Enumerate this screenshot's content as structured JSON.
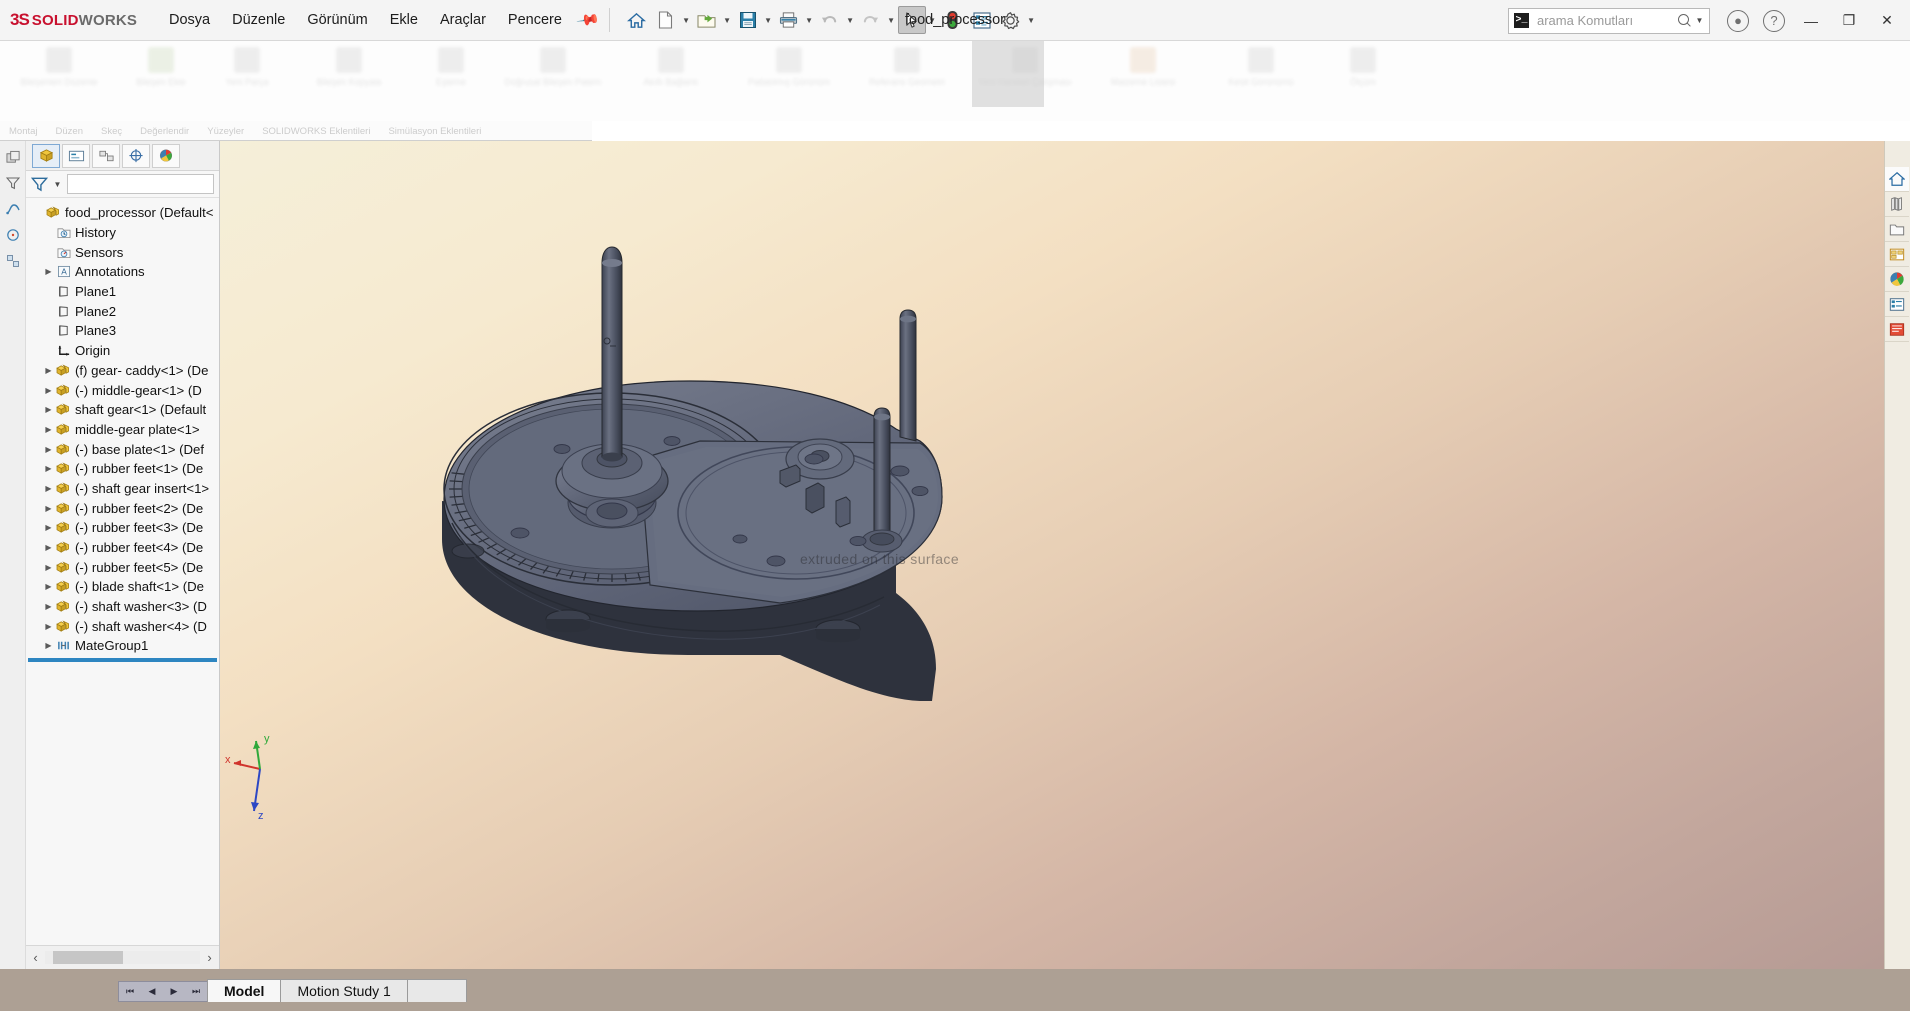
{
  "app": {
    "brand_ds": "3S",
    "brand_solid": "SOLID",
    "brand_works": "WORKS",
    "document_title": "food_processor",
    "accent_color": "#c8102e",
    "selection_color": "#2e86c1"
  },
  "menubar": {
    "items": [
      {
        "label": "Dosya",
        "name": "menu-file"
      },
      {
        "label": "Düzenle",
        "name": "menu-edit"
      },
      {
        "label": "Görünüm",
        "name": "menu-view"
      },
      {
        "label": "Ekle",
        "name": "menu-insert"
      },
      {
        "label": "Araçlar",
        "name": "menu-tools"
      },
      {
        "label": "Pencere",
        "name": "menu-window"
      }
    ],
    "pin_icon": "pushpin-icon"
  },
  "quick_access": {
    "buttons": [
      {
        "name": "home-button",
        "icon": "home-icon",
        "has_caret": false,
        "active": false
      },
      {
        "name": "new-document-button",
        "icon": "new-file-icon",
        "has_caret": true,
        "active": false
      },
      {
        "name": "open-document-button",
        "icon": "open-folder-icon",
        "has_caret": true,
        "active": false
      },
      {
        "name": "save-button",
        "icon": "save-floppy-icon",
        "has_caret": true,
        "active": false
      },
      {
        "name": "print-button",
        "icon": "printer-icon",
        "has_caret": true,
        "active": false
      },
      {
        "name": "undo-button",
        "icon": "undo-arrow-icon",
        "has_caret": true,
        "active": false
      },
      {
        "name": "redo-button",
        "icon": "redo-arrow-icon",
        "has_caret": false,
        "active": false
      },
      {
        "name": "select-tool-button",
        "icon": "cursor-arrow-icon",
        "has_caret": true,
        "active": true
      },
      {
        "name": "rebuild-button",
        "icon": "traffic-light-icon",
        "has_caret": false,
        "active": false
      },
      {
        "name": "options-button",
        "icon": "options-list-icon",
        "has_caret": false,
        "active": false
      },
      {
        "name": "settings-button",
        "icon": "gear-icon",
        "has_caret": true,
        "active": false
      }
    ]
  },
  "search": {
    "placeholder": "arama Komutları",
    "command_icon": "command-prompt-icon",
    "magnifier_icon": "search-icon"
  },
  "window_controls": {
    "account_icon": "user-account-icon",
    "help_icon": "help-question-icon",
    "minimize": "—",
    "restore": "❐",
    "close": "✕"
  },
  "ribbon": {
    "tabs": [
      "Montaj",
      "Düzen",
      "Skeç",
      "Değerlendir",
      "Yüzeyler",
      "SOLIDWORKS Eklentileri",
      "Simülasyon Eklentileri"
    ],
    "commands": [
      {
        "label": "Bileşenleri\nDüzenle",
        "tone": "gray"
      },
      {
        "label": "Bileşen\nEkle",
        "tone": "green"
      },
      {
        "label": "Yeni Parça",
        "tone": "gray"
      },
      {
        "label": "Bileşen\nKopyala",
        "tone": "gray"
      },
      {
        "label": "Eşleme",
        "tone": "gray"
      },
      {
        "label": "Doğrusal Bileşen\nPatern",
        "tone": "gray"
      },
      {
        "label": "Akıllı\nBağlantı",
        "tone": "gray"
      },
      {
        "label": "Patlatılmış\nGörünüm",
        "tone": "gray"
      },
      {
        "label": "Referans\nGeometri",
        "tone": "gray"
      },
      {
        "label": "Yeni Hareket\nÇalışması",
        "tone": "gray"
      },
      {
        "label": "Malzeme\nListesi",
        "tone": "orange"
      },
      {
        "label": "Kesit\nGörünümü",
        "tone": "gray"
      },
      {
        "label": "Ölçüm",
        "tone": "gray"
      }
    ]
  },
  "feature_tree": {
    "tabs": [
      {
        "name": "tree-tab-feature-manager",
        "icon": "assembly-tree-icon",
        "selected": true
      },
      {
        "name": "tree-tab-property-manager",
        "icon": "property-manager-icon",
        "selected": false
      },
      {
        "name": "tree-tab-configuration-manager",
        "icon": "configuration-icon",
        "selected": false
      },
      {
        "name": "tree-tab-dimxpert-manager",
        "icon": "dimxpert-icon",
        "selected": false
      },
      {
        "name": "tree-tab-display-manager",
        "icon": "display-manager-icon",
        "selected": false
      }
    ],
    "filter_icon": "filter-funnel-icon",
    "filter_value": "",
    "nodes": [
      {
        "label": "food_processor  (Default<",
        "icon": "assembly-icon",
        "indent": 0,
        "arrow": false
      },
      {
        "label": "History",
        "icon": "history-folder-icon",
        "indent": 1,
        "arrow": false
      },
      {
        "label": "Sensors",
        "icon": "sensors-folder-icon",
        "indent": 1,
        "arrow": false
      },
      {
        "label": "Annotations",
        "icon": "annotations-icon",
        "indent": 1,
        "arrow": true
      },
      {
        "label": "Plane1",
        "icon": "plane-icon",
        "indent": 1,
        "arrow": false
      },
      {
        "label": "Plane2",
        "icon": "plane-icon",
        "indent": 1,
        "arrow": false
      },
      {
        "label": "Plane3",
        "icon": "plane-icon",
        "indent": 1,
        "arrow": false
      },
      {
        "label": "Origin",
        "icon": "origin-icon",
        "indent": 1,
        "arrow": false
      },
      {
        "label": "(f) gear- caddy<1> (De",
        "icon": "component-icon",
        "indent": 1,
        "arrow": true
      },
      {
        "label": "(-) middle-gear<1> (D",
        "icon": "component-icon",
        "indent": 1,
        "arrow": true
      },
      {
        "label": "shaft gear<1> (Default",
        "icon": "component-icon",
        "indent": 1,
        "arrow": true
      },
      {
        "label": "middle-gear plate<1>",
        "icon": "component-icon",
        "indent": 1,
        "arrow": true
      },
      {
        "label": "(-) base plate<1> (Def",
        "icon": "component-icon",
        "indent": 1,
        "arrow": true
      },
      {
        "label": "(-) rubber feet<1> (De",
        "icon": "component-icon",
        "indent": 1,
        "arrow": true
      },
      {
        "label": "(-) shaft gear insert<1>",
        "icon": "component-icon",
        "indent": 1,
        "arrow": true
      },
      {
        "label": "(-) rubber feet<2> (De",
        "icon": "component-icon",
        "indent": 1,
        "arrow": true
      },
      {
        "label": "(-) rubber feet<3> (De",
        "icon": "component-icon",
        "indent": 1,
        "arrow": true
      },
      {
        "label": "(-) rubber feet<4> (De",
        "icon": "component-icon",
        "indent": 1,
        "arrow": true
      },
      {
        "label": "(-) rubber feet<5> (De",
        "icon": "component-icon",
        "indent": 1,
        "arrow": true
      },
      {
        "label": "(-) blade shaft<1> (De",
        "icon": "component-icon",
        "indent": 1,
        "arrow": true
      },
      {
        "label": "(-) shaft washer<3> (D",
        "icon": "component-icon",
        "indent": 1,
        "arrow": true
      },
      {
        "label": "(-) shaft washer<4> (D",
        "icon": "component-icon",
        "indent": 1,
        "arrow": true
      },
      {
        "label": "MateGroup1",
        "icon": "mate-group-icon",
        "indent": 1,
        "arrow": true
      }
    ],
    "scroll_left_arrow": "‹",
    "scroll_right_arrow": "›"
  },
  "view_toolbar": {
    "buttons": [
      {
        "name": "zoom-to-fit-button",
        "icon": "zoom-fit-icon",
        "caret": false
      },
      {
        "name": "zoom-to-area-button",
        "icon": "zoom-area-icon",
        "caret": false
      },
      {
        "name": "previous-view-button",
        "icon": "previous-view-icon",
        "caret": false
      },
      {
        "name": "section-view-button",
        "icon": "section-view-icon",
        "caret": false
      },
      {
        "name": "view-orientation-button",
        "icon": "view-orientation-icon",
        "caret": true
      },
      {
        "name": "display-style-button",
        "icon": "display-style-cube-icon",
        "caret": true
      },
      {
        "name": "hide-show-items-button",
        "icon": "hide-show-eye-icon",
        "caret": true
      },
      {
        "name": "edit-appearance-button",
        "icon": "appearance-palette-icon",
        "caret": false
      },
      {
        "name": "apply-scene-button",
        "icon": "scene-sphere-icon",
        "caret": true
      },
      {
        "name": "view-settings-button",
        "icon": "viewport-monitor-icon",
        "caret": true
      }
    ]
  },
  "document_window_controls": {
    "restore_down": "❐",
    "maximize": "❑",
    "minimize": "—",
    "close": "✕"
  },
  "task_pane": {
    "buttons": [
      {
        "name": "task-pane-resources",
        "icon": "home-icon",
        "selected": true
      },
      {
        "name": "task-pane-design-library",
        "icon": "design-library-icon",
        "selected": false
      },
      {
        "name": "task-pane-file-explorer",
        "icon": "file-explorer-folder-icon",
        "selected": false
      },
      {
        "name": "task-pane-view-palette",
        "icon": "view-palette-icon",
        "selected": false
      },
      {
        "name": "task-pane-appearances",
        "icon": "appearances-sphere-icon",
        "selected": false
      },
      {
        "name": "task-pane-custom-properties",
        "icon": "custom-properties-icon",
        "selected": false
      },
      {
        "name": "task-pane-solidworks-forum",
        "icon": "forum-icon",
        "selected": false
      }
    ]
  },
  "graphics": {
    "watermark_text": "extruded on this surface",
    "triad": {
      "x_label": "x",
      "y_label": "y",
      "z_label": "z"
    },
    "model_name": "food_processor assembly"
  },
  "bottom_tabs": {
    "nav": [
      "⏮",
      "◀",
      "▶",
      "⏭"
    ],
    "tabs": [
      {
        "label": "Model",
        "active": true
      },
      {
        "label": "Motion Study 1",
        "active": false
      }
    ]
  }
}
